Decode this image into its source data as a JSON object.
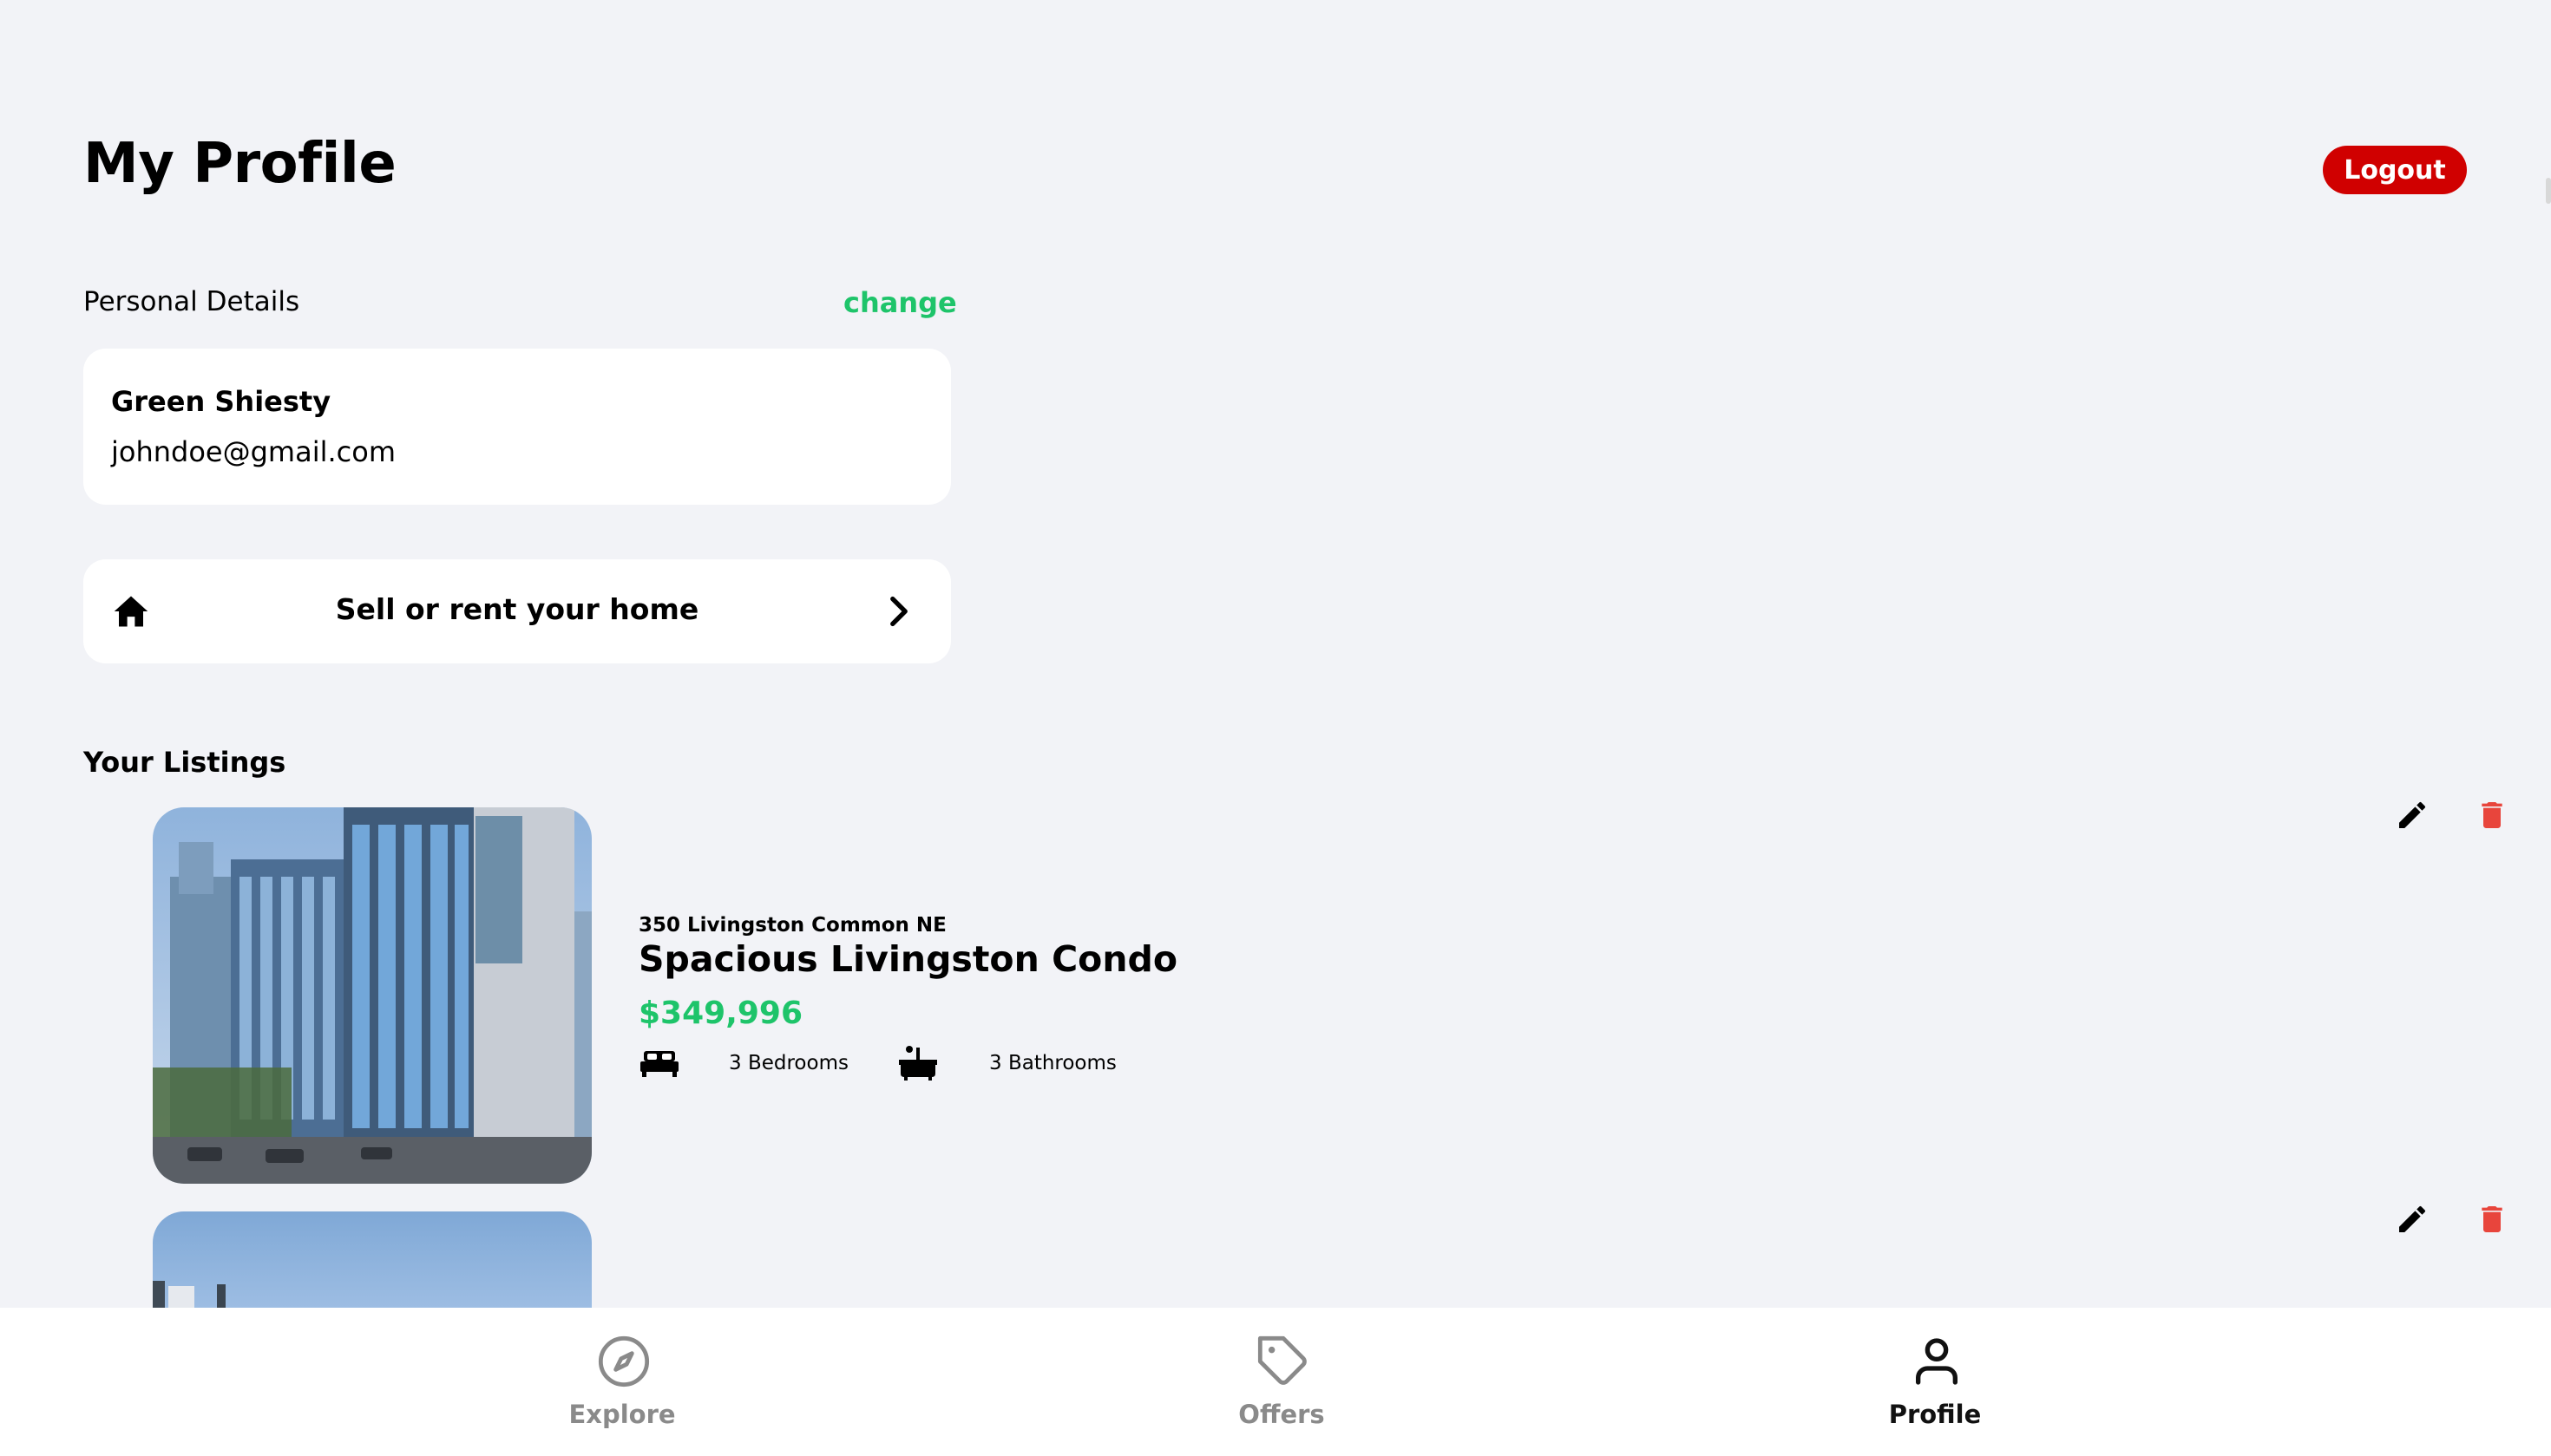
{
  "header": {
    "title": "My Profile",
    "logout_label": "Logout"
  },
  "personal_details": {
    "label": "Personal Details",
    "change_label": "change",
    "name": "Green Shiesty",
    "email": "johndoe@gmail.com"
  },
  "sell_card": {
    "label": "Sell or rent your home",
    "icon": "home-icon",
    "chevron": "chevron-right-icon"
  },
  "listings": {
    "heading": "Your Listings",
    "items": [
      {
        "address": "350 Livingston Common NE",
        "title": "Spacious Livingston Condo",
        "price": "$349,996",
        "bedrooms": "3 Bedrooms",
        "bathrooms": "3 Bathrooms"
      }
    ]
  },
  "tabbar": {
    "tabs": [
      {
        "label": "Explore",
        "icon": "compass-icon",
        "active": false
      },
      {
        "label": "Offers",
        "icon": "tag-icon",
        "active": false
      },
      {
        "label": "Profile",
        "icon": "person-icon",
        "active": true
      }
    ]
  },
  "colors": {
    "accent_green": "#1ec46a",
    "logout_red": "#d00000",
    "trash_red": "#e8453c",
    "background": "#f2f3f7"
  }
}
